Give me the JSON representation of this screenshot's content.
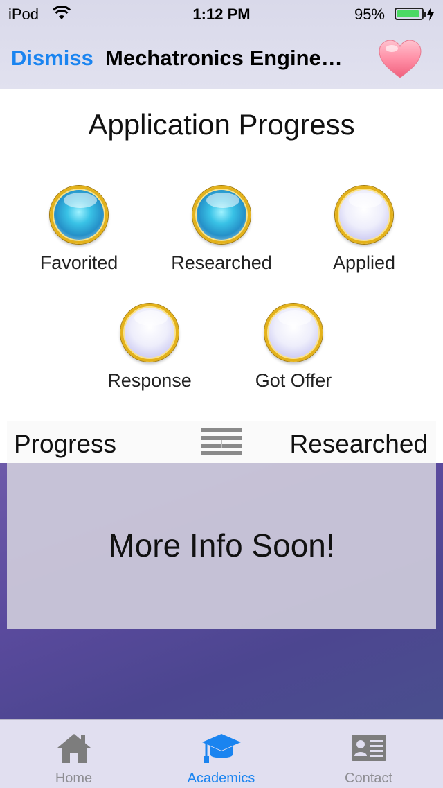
{
  "status": {
    "carrier": "iPod",
    "time": "1:12 PM",
    "battery": "95%",
    "battery_level": 0.95
  },
  "nav": {
    "dismiss": "Dismiss",
    "title": "Mechatronics Engine…",
    "favorite_icon": "heart-icon"
  },
  "progress": {
    "title": "Application Progress",
    "stages": [
      {
        "label": "Favorited",
        "completed": true
      },
      {
        "label": "Researched",
        "completed": true
      },
      {
        "label": "Applied",
        "completed": false
      },
      {
        "label": "Response",
        "completed": false
      },
      {
        "label": "Got Offer",
        "completed": false
      }
    ]
  },
  "strip": {
    "left": "Progress",
    "right": "Researched",
    "icon": "menu-icon"
  },
  "info": {
    "message": "More Info Soon!"
  },
  "tabs": [
    {
      "label": "Home",
      "icon": "home-icon",
      "active": false
    },
    {
      "label": "Academics",
      "icon": "graduation-cap-icon",
      "active": true
    },
    {
      "label": "Contact",
      "icon": "contact-card-icon",
      "active": false
    }
  ],
  "colors": {
    "accent": "#1a84f0",
    "battery": "#4cd964",
    "orb_ring": "#e4b21a"
  }
}
